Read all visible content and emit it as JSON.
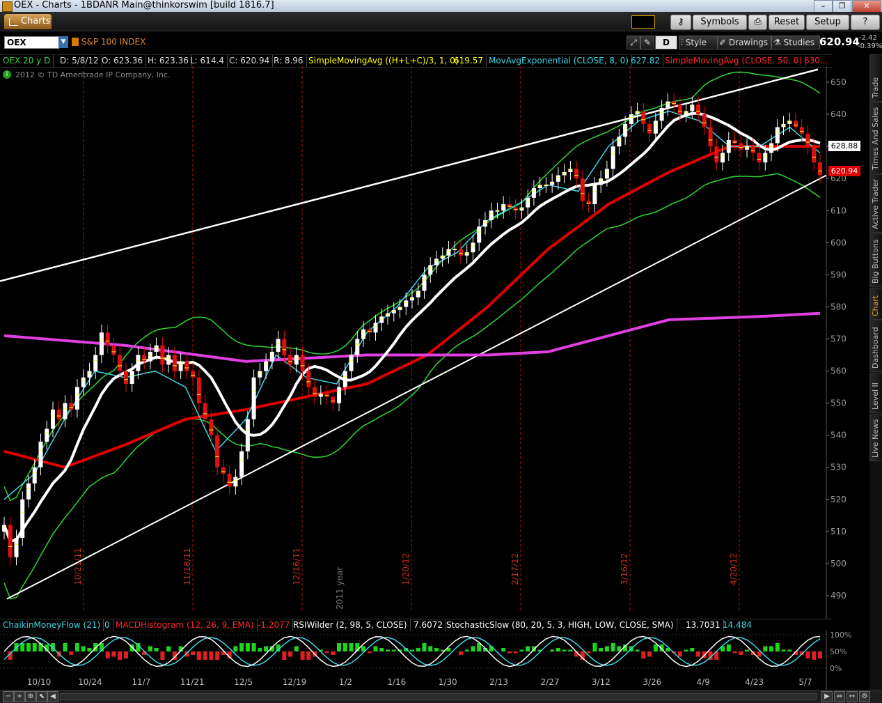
{
  "window": {
    "title": "OEX - Charts - 1BDANR Main@thinkorswim [build 1816.7]",
    "controls": [
      "–",
      "❐",
      "✕"
    ]
  },
  "toolbar": {
    "charts_tab": "Charts",
    "symbols_btn": "Symbols",
    "reset_btn": "Reset",
    "setup_btn": "Setup"
  },
  "symbol_bar": {
    "symbol": "OEX",
    "description": "S&P 100 INDEX",
    "buttons": {
      "d_btn": "D",
      "style": "Style",
      "drawings": "Drawings",
      "studies": "Studies"
    },
    "last_price": "620.94",
    "net_change": "-2.42",
    "pct_change": "-0.39%"
  },
  "study_header": {
    "period": "OEX 20 y D",
    "date": "D: 5/8/12",
    "open": "O: 623.36",
    "high": "H: 623.36",
    "low": "L: 614.4",
    "close": "C: 620.94",
    "range": "R: 8.96",
    "sma_hlc_label": "SimpleMovingAvg ((H+L+C)/3, 1, 0)",
    "sma_hlc_val": "619.57",
    "ema_label": "MovAvgExponential (CLOSE, 8, 0)",
    "ema_val": "627.82",
    "sma50_label": "SimpleMovingAvg (CLOSE, 50, 0)",
    "sma50_val": "630..."
  },
  "copyright": "2012 © TD Ameritrade IP Company, Inc.",
  "price_tags": {
    "white": "628.88",
    "red": "620.94"
  },
  "oscillator_header": {
    "cmf": "ChaikinMoneyFlow (21)",
    "cmf_val": "0",
    "macd": "MACDHistogram (12, 26, 9, EMA)",
    "macd_val": "-1.2077",
    "rsi": "RSIWilder (2, 98, 5, CLOSE)",
    "rsi_val": "7.6072",
    "stoch": "StochasticSlow (80, 20, 5, 3, HIGH, LOW, CLOSE, SMA)",
    "stoch_val1": "13.7031",
    "stoch_val2": "14.484"
  },
  "side_tabs": [
    "Trade",
    "Times And Sales",
    "Active Trader",
    "Big Buttons",
    "Chart",
    "Dashboard",
    "Level II",
    "Live News"
  ],
  "colors": {
    "background": "#000000",
    "up_candle": "#ffffff",
    "down_candle": "#e01010",
    "sma50": "#e00000",
    "white_ma": "#ffffff",
    "ema8": "#3fd6e6",
    "bollinger": "#2ecc2e",
    "sma200": "#e040e0",
    "month_lines": "#b01010",
    "channel": "#ffffff"
  },
  "chart_data": {
    "type": "candlestick",
    "symbol": "OEX",
    "ylim": [
      485,
      655
    ],
    "y_ticks": [
      490,
      500,
      510,
      520,
      530,
      540,
      550,
      560,
      570,
      580,
      590,
      600,
      610,
      620,
      630,
      640,
      650
    ],
    "x_labels": [
      "10/10",
      "10/24",
      "11/7",
      "11/21",
      "12/5",
      "12/19",
      "1/2",
      "1/16",
      "1/30",
      "2/13",
      "2/27",
      "3/12",
      "3/26",
      "4/9",
      "4/23",
      "5/7"
    ],
    "expiration_labels": [
      "10/21/11",
      "11/18/11",
      "12/16/11",
      "1/20/12",
      "2/17/12",
      "3/16/12",
      "4/20/12"
    ],
    "year_label": "2011 year",
    "close": [
      512,
      502,
      508,
      520,
      525,
      530,
      538,
      542,
      548,
      545,
      550,
      548,
      555,
      558,
      560,
      565,
      572,
      568,
      565,
      560,
      556,
      560,
      565,
      563,
      566,
      568,
      562,
      565,
      560,
      563,
      560,
      558,
      550,
      545,
      540,
      530,
      528,
      524,
      527,
      535,
      545,
      558,
      560,
      563,
      566,
      570,
      565,
      562,
      565,
      560,
      555,
      552,
      553,
      552,
      550,
      555,
      560,
      565,
      570,
      573,
      572,
      575,
      577,
      578,
      579,
      580,
      582,
      583,
      585,
      590,
      593,
      595,
      596,
      598,
      598,
      596,
      597,
      600,
      605,
      607,
      610,
      610,
      612,
      611,
      610,
      611,
      614,
      617,
      618,
      618,
      619,
      621,
      622,
      623,
      620,
      613,
      612,
      618,
      620,
      623,
      630,
      633,
      637,
      640,
      641,
      637,
      634,
      638,
      642,
      644,
      643,
      640,
      641,
      643,
      640,
      636,
      630,
      625,
      628,
      632,
      631,
      629,
      630,
      628,
      625,
      628,
      631,
      636,
      637,
      638,
      636,
      634,
      630,
      625,
      621
    ],
    "series": [
      {
        "name": "SimpleMovingAvg (CLOSE, 50, 0)",
        "color": "#e00000",
        "values": [
          [
            0,
            535
          ],
          [
            10,
            530
          ],
          [
            20,
            537
          ],
          [
            30,
            545
          ],
          [
            40,
            548
          ],
          [
            50,
            552
          ],
          [
            60,
            556
          ],
          [
            70,
            565
          ],
          [
            80,
            580
          ],
          [
            90,
            598
          ],
          [
            100,
            612
          ],
          [
            110,
            622
          ],
          [
            120,
            630
          ],
          [
            135,
            630
          ]
        ]
      },
      {
        "name": "MovAvgExponential (CLOSE, 8, 0)",
        "color": "#3fd6e6",
        "values": [
          [
            0,
            520
          ],
          [
            5,
            528
          ],
          [
            10,
            545
          ],
          [
            15,
            560
          ],
          [
            20,
            558
          ],
          [
            25,
            560
          ],
          [
            30,
            555
          ],
          [
            35,
            535
          ],
          [
            40,
            545
          ],
          [
            45,
            565
          ],
          [
            50,
            558
          ],
          [
            55,
            556
          ],
          [
            60,
            572
          ],
          [
            65,
            580
          ],
          [
            70,
            592
          ],
          [
            75,
            597
          ],
          [
            80,
            607
          ],
          [
            85,
            612
          ],
          [
            90,
            618
          ],
          [
            95,
            616
          ],
          [
            100,
            630
          ],
          [
            105,
            638
          ],
          [
            110,
            641
          ],
          [
            115,
            638
          ],
          [
            120,
            630
          ],
          [
            125,
            630
          ],
          [
            130,
            636
          ],
          [
            135,
            628
          ]
        ]
      },
      {
        "name": "SMA200",
        "color": "#e040e0",
        "values": [
          [
            0,
            571
          ],
          [
            20,
            568
          ],
          [
            40,
            563
          ],
          [
            60,
            565
          ],
          [
            70,
            565
          ],
          [
            80,
            565
          ],
          [
            90,
            566
          ],
          [
            100,
            571
          ],
          [
            110,
            576
          ],
          [
            125,
            577
          ],
          [
            135,
            578
          ]
        ]
      }
    ]
  }
}
